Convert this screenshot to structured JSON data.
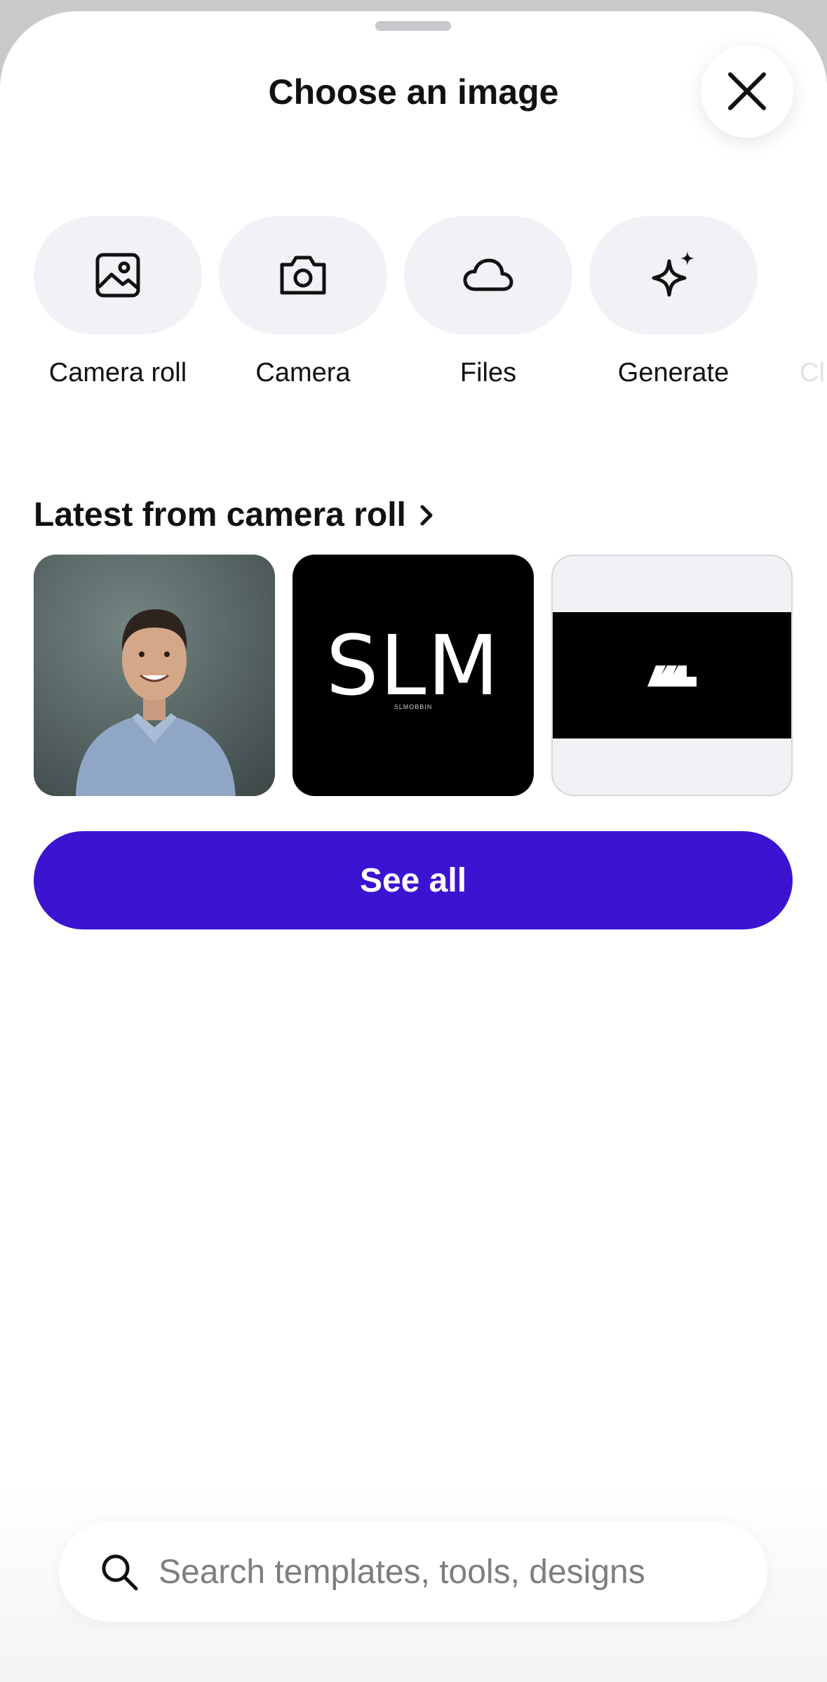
{
  "header": {
    "title": "Choose an image",
    "close_icon": "close-icon"
  },
  "sources": [
    {
      "label": "Camera roll",
      "icon": "image-icon"
    },
    {
      "label": "Camera",
      "icon": "camera-icon"
    },
    {
      "label": "Files",
      "icon": "cloud-icon"
    },
    {
      "label": "Generate",
      "icon": "sparkle-icon"
    },
    {
      "label": "Cl",
      "icon": ""
    }
  ],
  "camera_roll": {
    "title": "Latest from camera roll",
    "chevron_icon": "chevron-right-icon",
    "thumbnails": [
      {
        "kind": "portrait-photo"
      },
      {
        "kind": "logo",
        "logo_text": "SLM",
        "logo_subtext": "SLMOBBIN"
      },
      {
        "kind": "mobbin-logo"
      }
    ]
  },
  "see_all_label": "See all",
  "search": {
    "placeholder": "Search templates, tools, designs",
    "value": ""
  },
  "colors": {
    "accent": "#3a14d1",
    "pill_bg": "#f1f2f5"
  }
}
